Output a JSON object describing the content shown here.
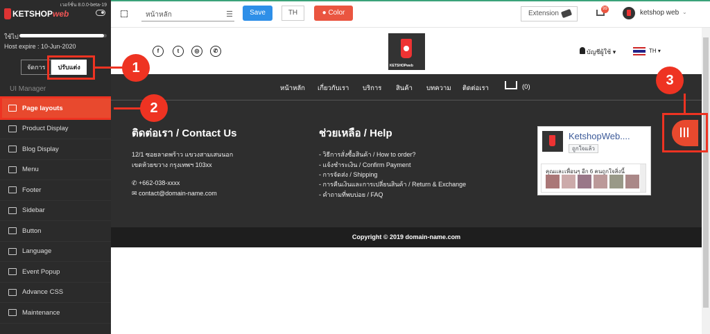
{
  "sidebar": {
    "version": "เวอร์ชั่น 8.0.0-beta-19",
    "brand": "KETSHOP",
    "brand_suffix": "web",
    "usage_label": "ใช้ไป",
    "usage_fraction": 0.97,
    "expire": "Host expire : 10-Jun-2020",
    "tabs": [
      {
        "label": "จัดการ"
      },
      {
        "label": "ปรับแต่ง"
      }
    ],
    "section_title": "UI Manager",
    "items": [
      {
        "label": "Page layouts",
        "icon": "layout-icon"
      },
      {
        "label": "Product Display",
        "icon": "product-icon"
      },
      {
        "label": "Blog Display",
        "icon": "blog-icon"
      },
      {
        "label": "Menu",
        "icon": "menu-icon"
      },
      {
        "label": "Footer",
        "icon": "footer-icon"
      },
      {
        "label": "Sidebar",
        "icon": "sidebar-icon"
      },
      {
        "label": "Button",
        "icon": "toggle-icon"
      },
      {
        "label": "Language",
        "icon": "language-icon"
      },
      {
        "label": "Event Popup",
        "icon": "popup-icon"
      },
      {
        "label": "Advance CSS",
        "icon": "css-icon"
      },
      {
        "label": "Maintenance",
        "icon": "bug-icon"
      }
    ]
  },
  "callouts": [
    "1",
    "2",
    "3"
  ],
  "topbar": {
    "page_select": "หน้าหลัก",
    "save": "Save",
    "lang": "TH",
    "color": "Color",
    "extension": "Extension",
    "cart_badge": "99",
    "user": "ketshop web"
  },
  "site": {
    "logo_text": "KETSHOPweb",
    "social": [
      "f",
      "t",
      "ig",
      "ph"
    ],
    "account": "บัญชีผู้ใช้ ▾",
    "lang": "TH ▾",
    "nav": [
      "หน้าหลัก",
      "เกี่ยวกับเรา",
      "บริการ",
      "สินค้า",
      "บทความ",
      "ติดต่อเรา"
    ],
    "cart_count": "(0)",
    "contact": {
      "title": "ติดต่อเรา / Contact Us",
      "addr1": "12/1 ซอยลาดพร้าว แขวงสามเสนนอก",
      "addr2": "เขตห้วยขวาง กรุงเทพฯ 103xx",
      "phone": "+662-038-xxxx",
      "email": "contact@domain-name.com"
    },
    "help": {
      "title": "ช่วยเหลือ / Help",
      "links": [
        "- วิธีการสั่งซื้อสินค้า / How to order?",
        "- แจ้งชำระเงิน / Confirm Payment",
        "- การจัดส่ง / Shipping",
        "- การคืนเงินและการเปลี่ยนสินค้า / Return & Exchange",
        "- คำถามที่พบบ่อย / FAQ"
      ]
    },
    "fb": {
      "name": "KetshopWeb....",
      "like": "ถูกใจแล้ว",
      "friends": "คุณและเพื่อนๆ อีก 6 คนถูกใจสิ่งนี้"
    },
    "copyright": "Copyright © 2019 domain-name.com"
  }
}
